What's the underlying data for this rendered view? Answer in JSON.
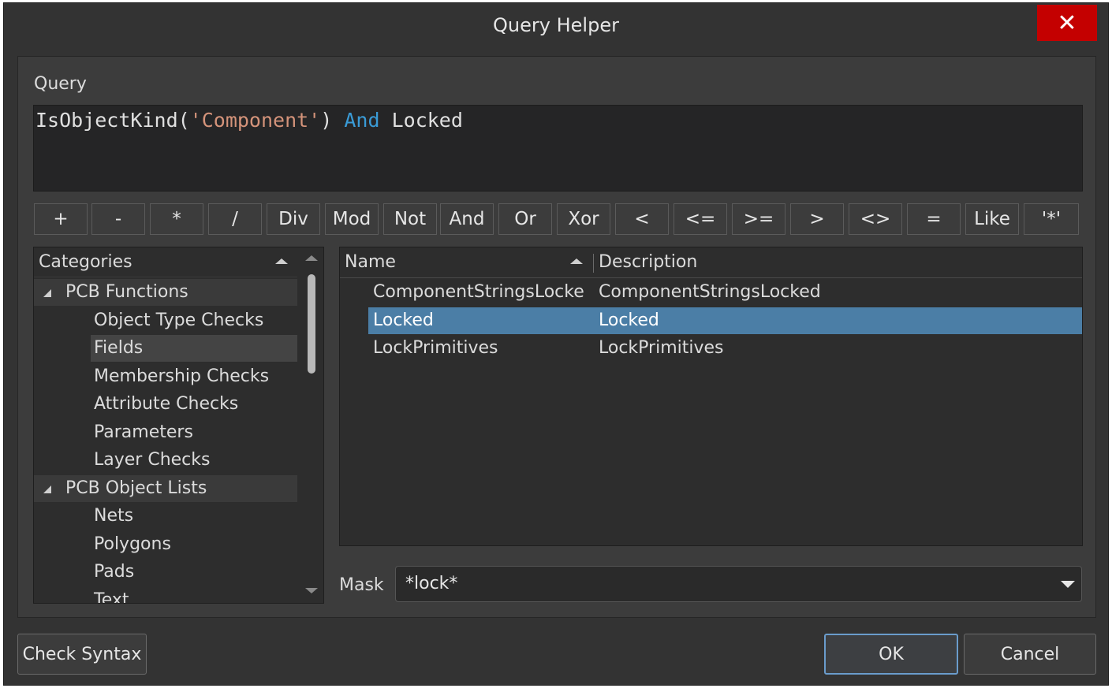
{
  "window": {
    "title": "Query Helper"
  },
  "query": {
    "label": "Query",
    "tokens": {
      "fn": "IsObjectKind(",
      "str": "'Component'",
      "close": ")",
      "kw": "And",
      "field": "Locked"
    }
  },
  "operators": [
    "+",
    "-",
    "*",
    "/",
    "Div",
    "Mod",
    "Not",
    "And",
    "Or",
    "Xor",
    "<",
    "<=",
    ">=",
    ">",
    "<>",
    "=",
    "Like",
    "'*'"
  ],
  "categories": {
    "header": "Categories",
    "items": [
      {
        "label": "PCB Functions",
        "level": 0,
        "expanded": true
      },
      {
        "label": "Object Type Checks",
        "level": 1
      },
      {
        "label": "Fields",
        "level": 1,
        "selected": true
      },
      {
        "label": "Membership Checks",
        "level": 1
      },
      {
        "label": "Attribute Checks",
        "level": 1
      },
      {
        "label": "Parameters",
        "level": 1
      },
      {
        "label": "Layer Checks",
        "level": 1
      },
      {
        "label": "PCB Object Lists",
        "level": 0,
        "expanded": true
      },
      {
        "label": "Nets",
        "level": 1
      },
      {
        "label": "Polygons",
        "level": 1
      },
      {
        "label": "Pads",
        "level": 1
      },
      {
        "label": "Text",
        "level": 1
      }
    ]
  },
  "list": {
    "columns": {
      "name": "Name",
      "description": "Description"
    },
    "rows": [
      {
        "name": "ComponentStringsLocke",
        "description": "ComponentStringsLocked"
      },
      {
        "name": "Locked",
        "description": "Locked",
        "selected": true
      },
      {
        "name": "LockPrimitives",
        "description": "LockPrimitives"
      }
    ]
  },
  "mask": {
    "label": "Mask",
    "value": "*lock*"
  },
  "buttons": {
    "check_syntax": "Check Syntax",
    "ok": "OK",
    "cancel": "Cancel",
    "close": "✕"
  },
  "colors": {
    "selection": "#4b7ea6",
    "keyword": "#3a9bd6",
    "string": "#d4937a",
    "close": "#c40000"
  }
}
